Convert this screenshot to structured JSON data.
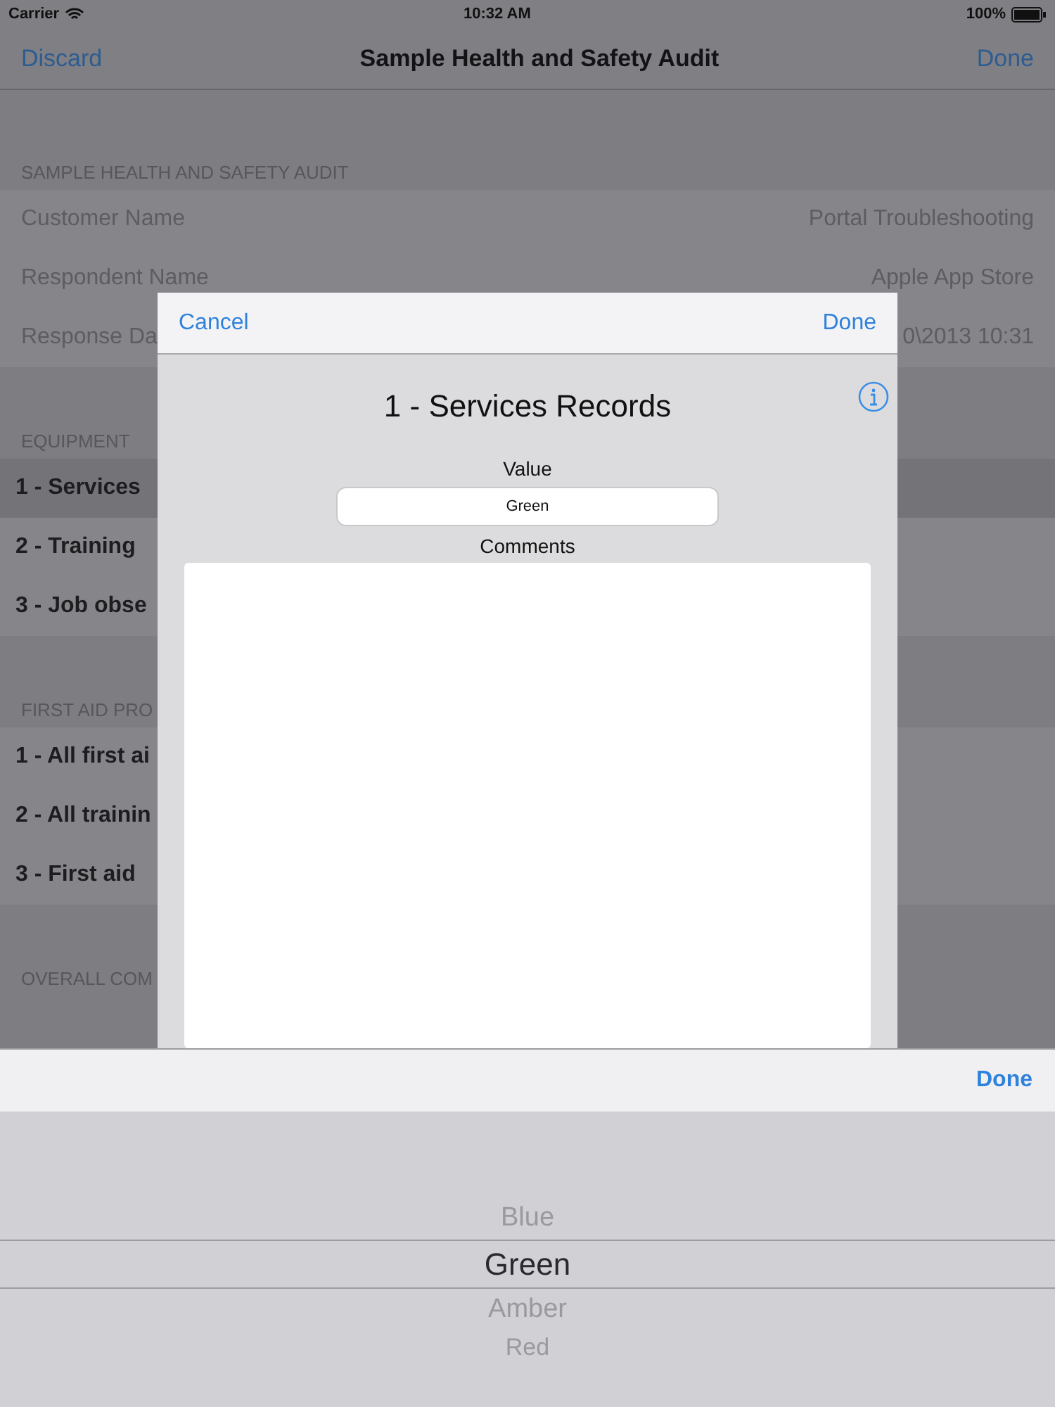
{
  "status_bar": {
    "carrier": "Carrier",
    "time": "10:32 AM",
    "battery": "100%"
  },
  "nav_bar": {
    "left_button": "Discard",
    "title": "Sample Health and Safety Audit",
    "right_button": "Done"
  },
  "sections": [
    {
      "header": "SAMPLE HEALTH AND SAFETY AUDIT",
      "rows": [
        {
          "kind": "field",
          "label": "Customer Name",
          "value": "Portal Troubleshooting",
          "selected": false
        },
        {
          "kind": "field",
          "label": "Respondent Name",
          "value": "Apple App Store",
          "selected": false
        },
        {
          "kind": "field",
          "label": "Response Da",
          "value": "0\\2013 10:31",
          "selected": false
        }
      ]
    },
    {
      "header": "EQUIPMENT",
      "rows": [
        {
          "kind": "question",
          "label": "1 - Services",
          "selected": true
        },
        {
          "kind": "question",
          "label": "2 - Training",
          "selected": false
        },
        {
          "kind": "question",
          "label": "3 - Job obse",
          "selected": false
        }
      ]
    },
    {
      "header": "FIRST AID PRO",
      "rows": [
        {
          "kind": "question",
          "label": "1 - All first ai",
          "selected": false
        },
        {
          "kind": "question",
          "label": "2 - All trainin",
          "selected": false
        },
        {
          "kind": "question",
          "label": "3 - First aid",
          "selected": false
        }
      ]
    },
    {
      "header": "OVERALL COM"
    }
  ],
  "dialog": {
    "cancel": "Cancel",
    "done": "Done",
    "title": "1 - Services Records",
    "value_label": "Value",
    "value": "Green",
    "comments_label": "Comments"
  },
  "picker": {
    "done": "Done",
    "options": [
      {
        "label": "Blue",
        "selected": false
      },
      {
        "label": "Green",
        "selected": true
      },
      {
        "label": "Amber",
        "selected": false
      },
      {
        "label": "Red",
        "selected": false
      }
    ]
  }
}
